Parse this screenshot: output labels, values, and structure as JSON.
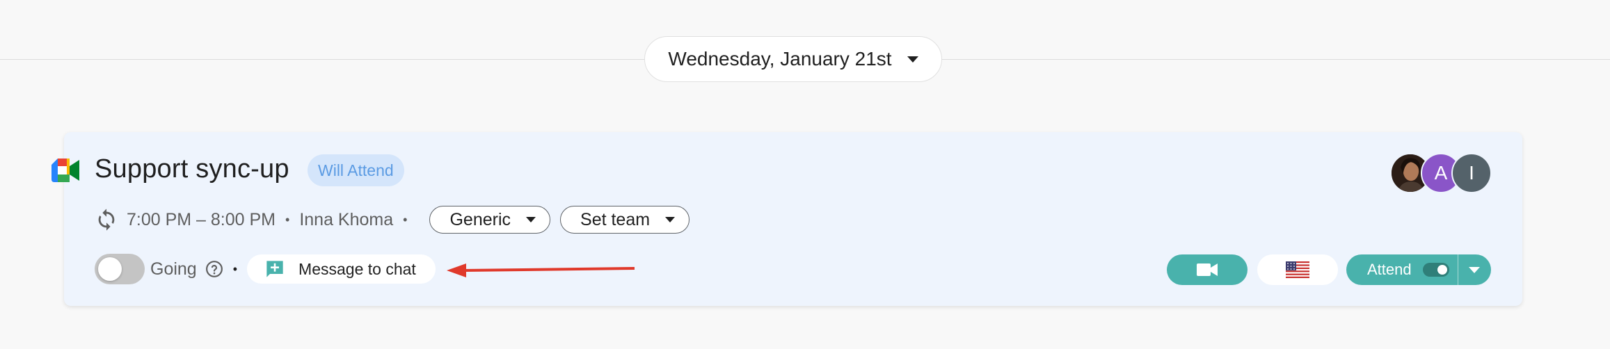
{
  "date_selector": {
    "label": "Wednesday, January 21st"
  },
  "event": {
    "title": "Support sync-up",
    "status_badge": "Will Attend",
    "time": "7:00 PM – 8:00 PM",
    "organizer": "Inna Khoma",
    "separator": "•",
    "category_chip": "Generic",
    "team_chip": "Set team",
    "going_label": "Going",
    "chat_button": "Message to chat",
    "attend_label": "Attend",
    "attendees": [
      {
        "initial": "",
        "icon": "photo-avatar"
      },
      {
        "initial": "A",
        "color": "#8a55c8"
      },
      {
        "initial": "I",
        "color": "#54626a"
      }
    ]
  },
  "icons": {
    "meet": "google-meet-icon",
    "recurring": "recurring-icon",
    "help": "help-circle-icon",
    "chat": "add-chat-icon",
    "video": "video-camera-icon",
    "flag": "us-flag-icon"
  },
  "colors": {
    "accent_teal": "#49b2ac",
    "badge_bg": "#d4e5fb",
    "badge_text": "#5b9be3",
    "card_bg": "#eef4fd",
    "annotation_arrow": "#e0392b"
  }
}
